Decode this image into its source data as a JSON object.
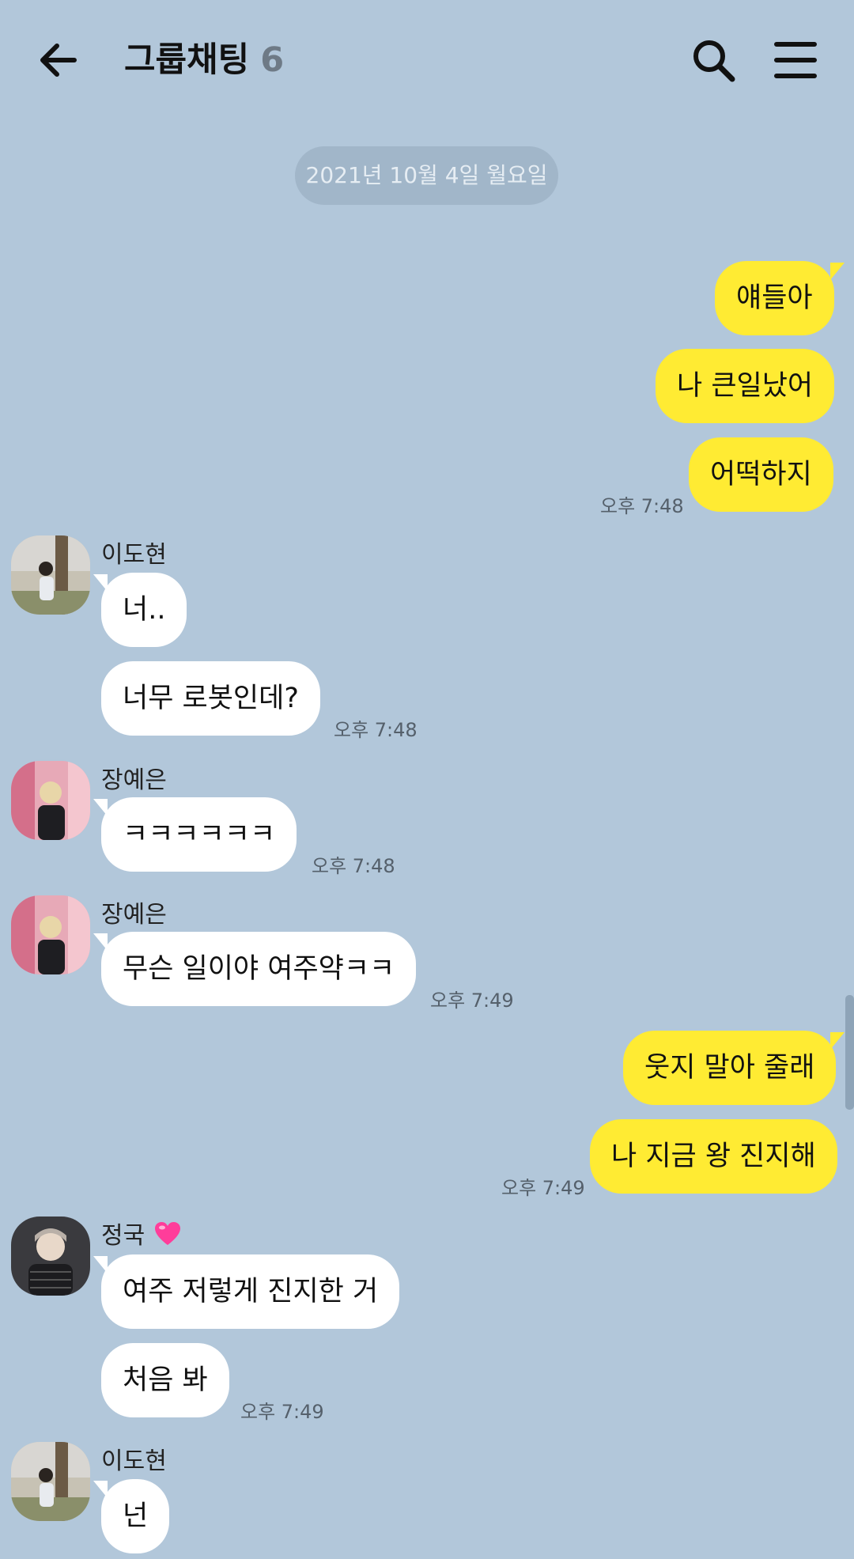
{
  "header": {
    "title": "그룹채팅",
    "member_count": "6"
  },
  "date_divider": "2021년 10월 4일 월요일",
  "messages": {
    "m1": "얘들아",
    "m2": "나 큰일났어",
    "m3": "어떡하지",
    "m3_time": "오후 7:48",
    "dohyun1_name": "이도현",
    "m4": "너..",
    "m5": "너무 로봇인데?",
    "m5_time": "오후 7:48",
    "yeeun1_name": "장예은",
    "m6": "ㅋㅋㅋㅋㅋㅋ",
    "m6_time": "오후 7:48",
    "yeeun2_name": "장예은",
    "m7": "무슨 일이야 여주약ㅋㅋ",
    "m7_time": "오후 7:49",
    "m8": "웃지 말아 줄래",
    "m9": "나 지금 왕 진지해",
    "m9_time": "오후 7:49",
    "jk_name": "정국",
    "m10": "여주 저렇게 진지한 거",
    "m11": "처음 봐",
    "m11_time": "오후 7:49",
    "dohyun2_name": "이도현",
    "m12": "넌"
  },
  "colors": {
    "background": "#b2c7da",
    "my_bubble": "#ffeb33",
    "other_bubble": "#ffffff"
  }
}
